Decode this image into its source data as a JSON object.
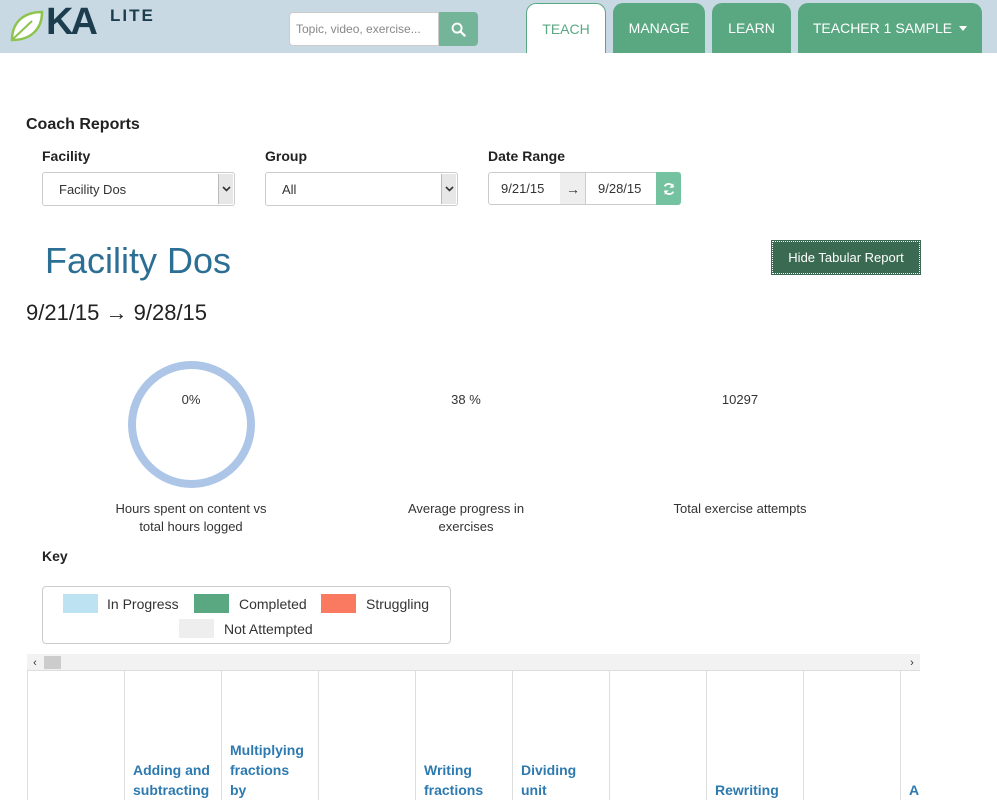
{
  "brand": {
    "ka": "KA",
    "lite": "LITE"
  },
  "search": {
    "placeholder": "Topic, video, exercise..."
  },
  "nav": {
    "teach": "TEACH",
    "manage": "MANAGE",
    "learn": "LEARN",
    "user": "TEACHER 1 SAMPLE"
  },
  "page": {
    "heading": "Coach Reports"
  },
  "filters": {
    "facility_label": "Facility",
    "facility_value": "Facility Dos",
    "group_label": "Group",
    "group_value": "All",
    "date_label": "Date Range",
    "date_start": "9/21/15",
    "date_arrow": "→",
    "date_end": "9/28/15"
  },
  "report": {
    "title": "Facility Dos",
    "hide_button": "Hide Tabular Report",
    "range": "9/21/15 → 9/28/15"
  },
  "stats": [
    {
      "value": "0%",
      "caption_line1": "Hours spent on content vs",
      "caption_line2": "total hours logged"
    },
    {
      "value": "38 %",
      "caption_line1": "Average progress in",
      "caption_line2": "exercises"
    },
    {
      "value": "10297",
      "caption_line1": "Total exercise attempts",
      "caption_line2": ""
    }
  ],
  "key": {
    "title": "Key",
    "in_progress": "In Progress",
    "completed": "Completed",
    "struggling": "Struggling",
    "not_attempted": "Not Attempted"
  },
  "colors": {
    "in_progress": "#bde3f3",
    "completed": "#5aa882",
    "struggling": "#fa7a61",
    "not_attempted": "#eeeeee",
    "accent": "#5aa882",
    "title": "#2d6f94"
  },
  "table": {
    "columns": [
      {
        "line1": "",
        "line2": "",
        "line3": ""
      },
      {
        "line1": "",
        "line2": "Adding and",
        "line3": "subtracting"
      },
      {
        "line1": "Multiplying",
        "line2": "fractions",
        "line3": "by"
      },
      {
        "line1": "",
        "line2": "",
        "line3": ""
      },
      {
        "line1": "",
        "line2": "Writing",
        "line3": "fractions"
      },
      {
        "line1": "",
        "line2": "Dividing",
        "line3": "unit"
      },
      {
        "line1": "",
        "line2": "",
        "line3": ""
      },
      {
        "line1": "",
        "line2": "",
        "line3": "Rewriting"
      },
      {
        "line1": "",
        "line2": "",
        "line3": ""
      },
      {
        "line1": "",
        "line2": "",
        "line3": "A"
      }
    ]
  }
}
